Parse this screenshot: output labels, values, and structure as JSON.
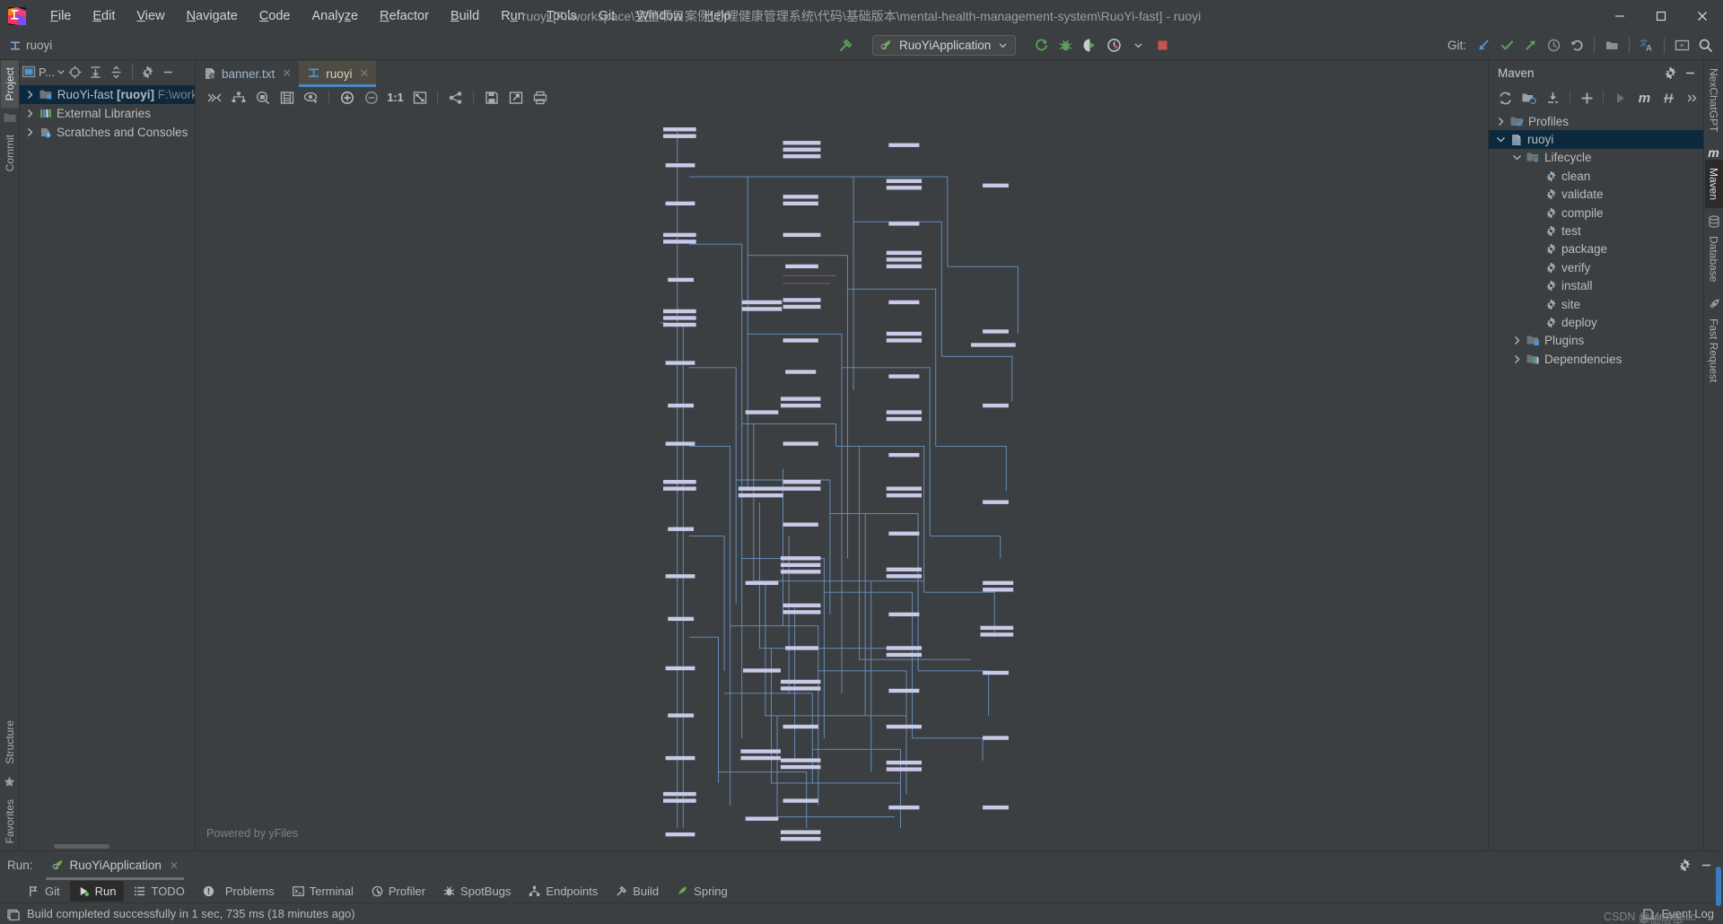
{
  "window": {
    "title": "ruoyi [F:\\workspace\\完整项目案例\\心理健康管理系统\\代码\\基础版本\\mental-health-management-system\\RuoYi-fast] - ruoyi",
    "minimize_label": "—",
    "maximize_label": "❐",
    "close_label": "✕"
  },
  "menubar": {
    "items": [
      {
        "label": "File",
        "mn": "F"
      },
      {
        "label": "Edit",
        "mn": "E"
      },
      {
        "label": "View",
        "mn": "V"
      },
      {
        "label": "Navigate",
        "mn": "N"
      },
      {
        "label": "Code",
        "mn": "C"
      },
      {
        "label": "Analyze",
        "mn": "z"
      },
      {
        "label": "Refactor",
        "mn": "R"
      },
      {
        "label": "Build",
        "mn": "B"
      },
      {
        "label": "Run",
        "mn": "u"
      },
      {
        "label": "Tools",
        "mn": "T"
      },
      {
        "label": "Git",
        "mn": ""
      },
      {
        "label": "Window",
        "mn": "W"
      },
      {
        "label": "Help",
        "mn": "H"
      }
    ]
  },
  "toolbar": {
    "project_chip": "ruoyi",
    "run_config": "RuoYiApplication",
    "git_label": "Git:",
    "icons": {
      "build": "hammer-icon",
      "rerun": "rerun-icon",
      "debug": "debug-icon",
      "coverage": "run-with-coverage-icon",
      "profiler": "profiler-icon",
      "stop": "stop-icon",
      "git_update": "git-update-icon",
      "git_commit": "git-commit-icon",
      "git_push": "git-push-icon",
      "git_history": "git-history-icon",
      "git_rollback": "git-rollback-icon",
      "project_structure": "project-structure-icon",
      "translate": "translate-icon",
      "presentation": "presentation-icon",
      "search": "search-icon"
    }
  },
  "left_rail": {
    "top": [
      "Project",
      "Commit"
    ],
    "bottom": [
      "Structure",
      "Favorites"
    ]
  },
  "project_panel": {
    "title": "P...",
    "tree": [
      {
        "label": "RuoYi-fast",
        "bold": "[ruoyi]",
        "path": "F:\\work",
        "selected": true,
        "icon": "module-icon",
        "indent": 0,
        "expandable": true
      },
      {
        "label": "External Libraries",
        "selected": false,
        "icon": "libraries-icon",
        "indent": 0,
        "expandable": true
      },
      {
        "label": "Scratches and Consoles",
        "selected": false,
        "icon": "scratches-icon",
        "indent": 0,
        "expandable": true
      }
    ],
    "icons": {
      "select_opened": "crosshair-icon",
      "expand_all": "expand-all-icon",
      "collapse_all": "collapse-all-icon",
      "settings": "gear-icon",
      "hide": "minimize-icon"
    }
  },
  "editor": {
    "tabs": [
      {
        "label": "banner.txt",
        "icon": "text-file-icon",
        "active": false
      },
      {
        "label": "ruoyi",
        "icon": "uml-diagram-icon",
        "active": true
      }
    ],
    "diagram_toolbar": {
      "icons": [
        "expand-collapse-icon",
        "layout-hierarchic-icon",
        "zoom-to-selection-icon",
        "show-fields-icon",
        "visibility-icon",
        "zoom-in-icon",
        "zoom-out-icon",
        "actual-size-icon",
        "fit-content-icon",
        "show-dependencies-icon",
        "save-icon",
        "export-icon",
        "print-icon"
      ],
      "actual_size_label": "1:1"
    },
    "watermark": "Powered by yFiles"
  },
  "maven_panel": {
    "title": "Maven",
    "toolbar_icons": [
      "reload-icon",
      "add-maven-project-icon",
      "download-sources-icon",
      "plus-icon",
      "run-icon",
      "maven-m-icon",
      "toggle-skip-tests-icon",
      "more-icon"
    ],
    "tree": [
      {
        "label": "Profiles",
        "indent": 0,
        "expandable": true,
        "expanded": false,
        "icon": "profiles-icon",
        "selected": false
      },
      {
        "label": "ruoyi",
        "indent": 0,
        "expandable": true,
        "expanded": true,
        "icon": "maven-project-icon",
        "selected": true
      },
      {
        "label": "Lifecycle",
        "indent": 1,
        "expandable": true,
        "expanded": true,
        "icon": "folder-gear-icon",
        "selected": false
      },
      {
        "label": "clean",
        "indent": 2,
        "expandable": false,
        "icon": "goal-icon",
        "selected": false
      },
      {
        "label": "validate",
        "indent": 2,
        "expandable": false,
        "icon": "goal-icon",
        "selected": false
      },
      {
        "label": "compile",
        "indent": 2,
        "expandable": false,
        "icon": "goal-icon",
        "selected": false
      },
      {
        "label": "test",
        "indent": 2,
        "expandable": false,
        "icon": "goal-icon",
        "selected": false
      },
      {
        "label": "package",
        "indent": 2,
        "expandable": false,
        "icon": "goal-icon",
        "selected": false
      },
      {
        "label": "verify",
        "indent": 2,
        "expandable": false,
        "icon": "goal-icon",
        "selected": false
      },
      {
        "label": "install",
        "indent": 2,
        "expandable": false,
        "icon": "goal-icon",
        "selected": false
      },
      {
        "label": "site",
        "indent": 2,
        "expandable": false,
        "icon": "goal-icon",
        "selected": false
      },
      {
        "label": "deploy",
        "indent": 2,
        "expandable": false,
        "icon": "goal-icon",
        "selected": false
      },
      {
        "label": "Plugins",
        "indent": 1,
        "expandable": true,
        "expanded": false,
        "icon": "plugins-icon",
        "selected": false
      },
      {
        "label": "Dependencies",
        "indent": 1,
        "expandable": true,
        "expanded": false,
        "icon": "dependencies-icon",
        "selected": false
      }
    ]
  },
  "right_rail": [
    {
      "label": "NexChatGPT",
      "active": false,
      "icon": ""
    },
    {
      "label": "Maven",
      "active": true,
      "icon": "maven-m-icon"
    },
    {
      "label": "Database",
      "active": false,
      "icon": "database-icon"
    },
    {
      "label": "Fast Request",
      "active": false,
      "icon": "rocket-icon"
    }
  ],
  "run_toolwindow": {
    "label": "Run:",
    "tab": "RuoYiApplication",
    "close": "✕",
    "settings_icon": "gear-icon",
    "hide_icon": "minimize-icon"
  },
  "bottom_tabs": [
    {
      "label": "Git",
      "icon": "git-branch-icon",
      "active": false
    },
    {
      "label": "Run",
      "icon": "run-icon",
      "active": true
    },
    {
      "label": "TODO",
      "icon": "todo-icon",
      "active": false
    },
    {
      "label": "Problems",
      "icon": "problems-icon",
      "active": false
    },
    {
      "label": "Terminal",
      "icon": "terminal-icon",
      "active": false
    },
    {
      "label": "Profiler",
      "icon": "profiler-icon",
      "active": false
    },
    {
      "label": "SpotBugs",
      "icon": "spotbugs-icon",
      "active": false
    },
    {
      "label": "Endpoints",
      "icon": "endpoints-icon",
      "active": false
    },
    {
      "label": "Build",
      "icon": "hammer-icon",
      "active": false
    },
    {
      "label": "Spring",
      "icon": "spring-leaf-icon",
      "active": false
    }
  ],
  "statusbar": {
    "message": "Build completed successfully in 1 sec, 735 ms (18 minutes ago)",
    "event_log": "Event Log",
    "watermark": "CSDN @Mr.Aholic",
    "watermark2": "基础版本"
  },
  "colors": {
    "accent_blue": "#4a88c7",
    "selection": "#0d293e",
    "panel_bg": "#3c3f41",
    "dark_bg": "#2b2b2b",
    "green": "#499c54",
    "red": "#c75450",
    "diagram_node": "#c9c9e8",
    "diagram_edge": "#6b9bd1"
  }
}
